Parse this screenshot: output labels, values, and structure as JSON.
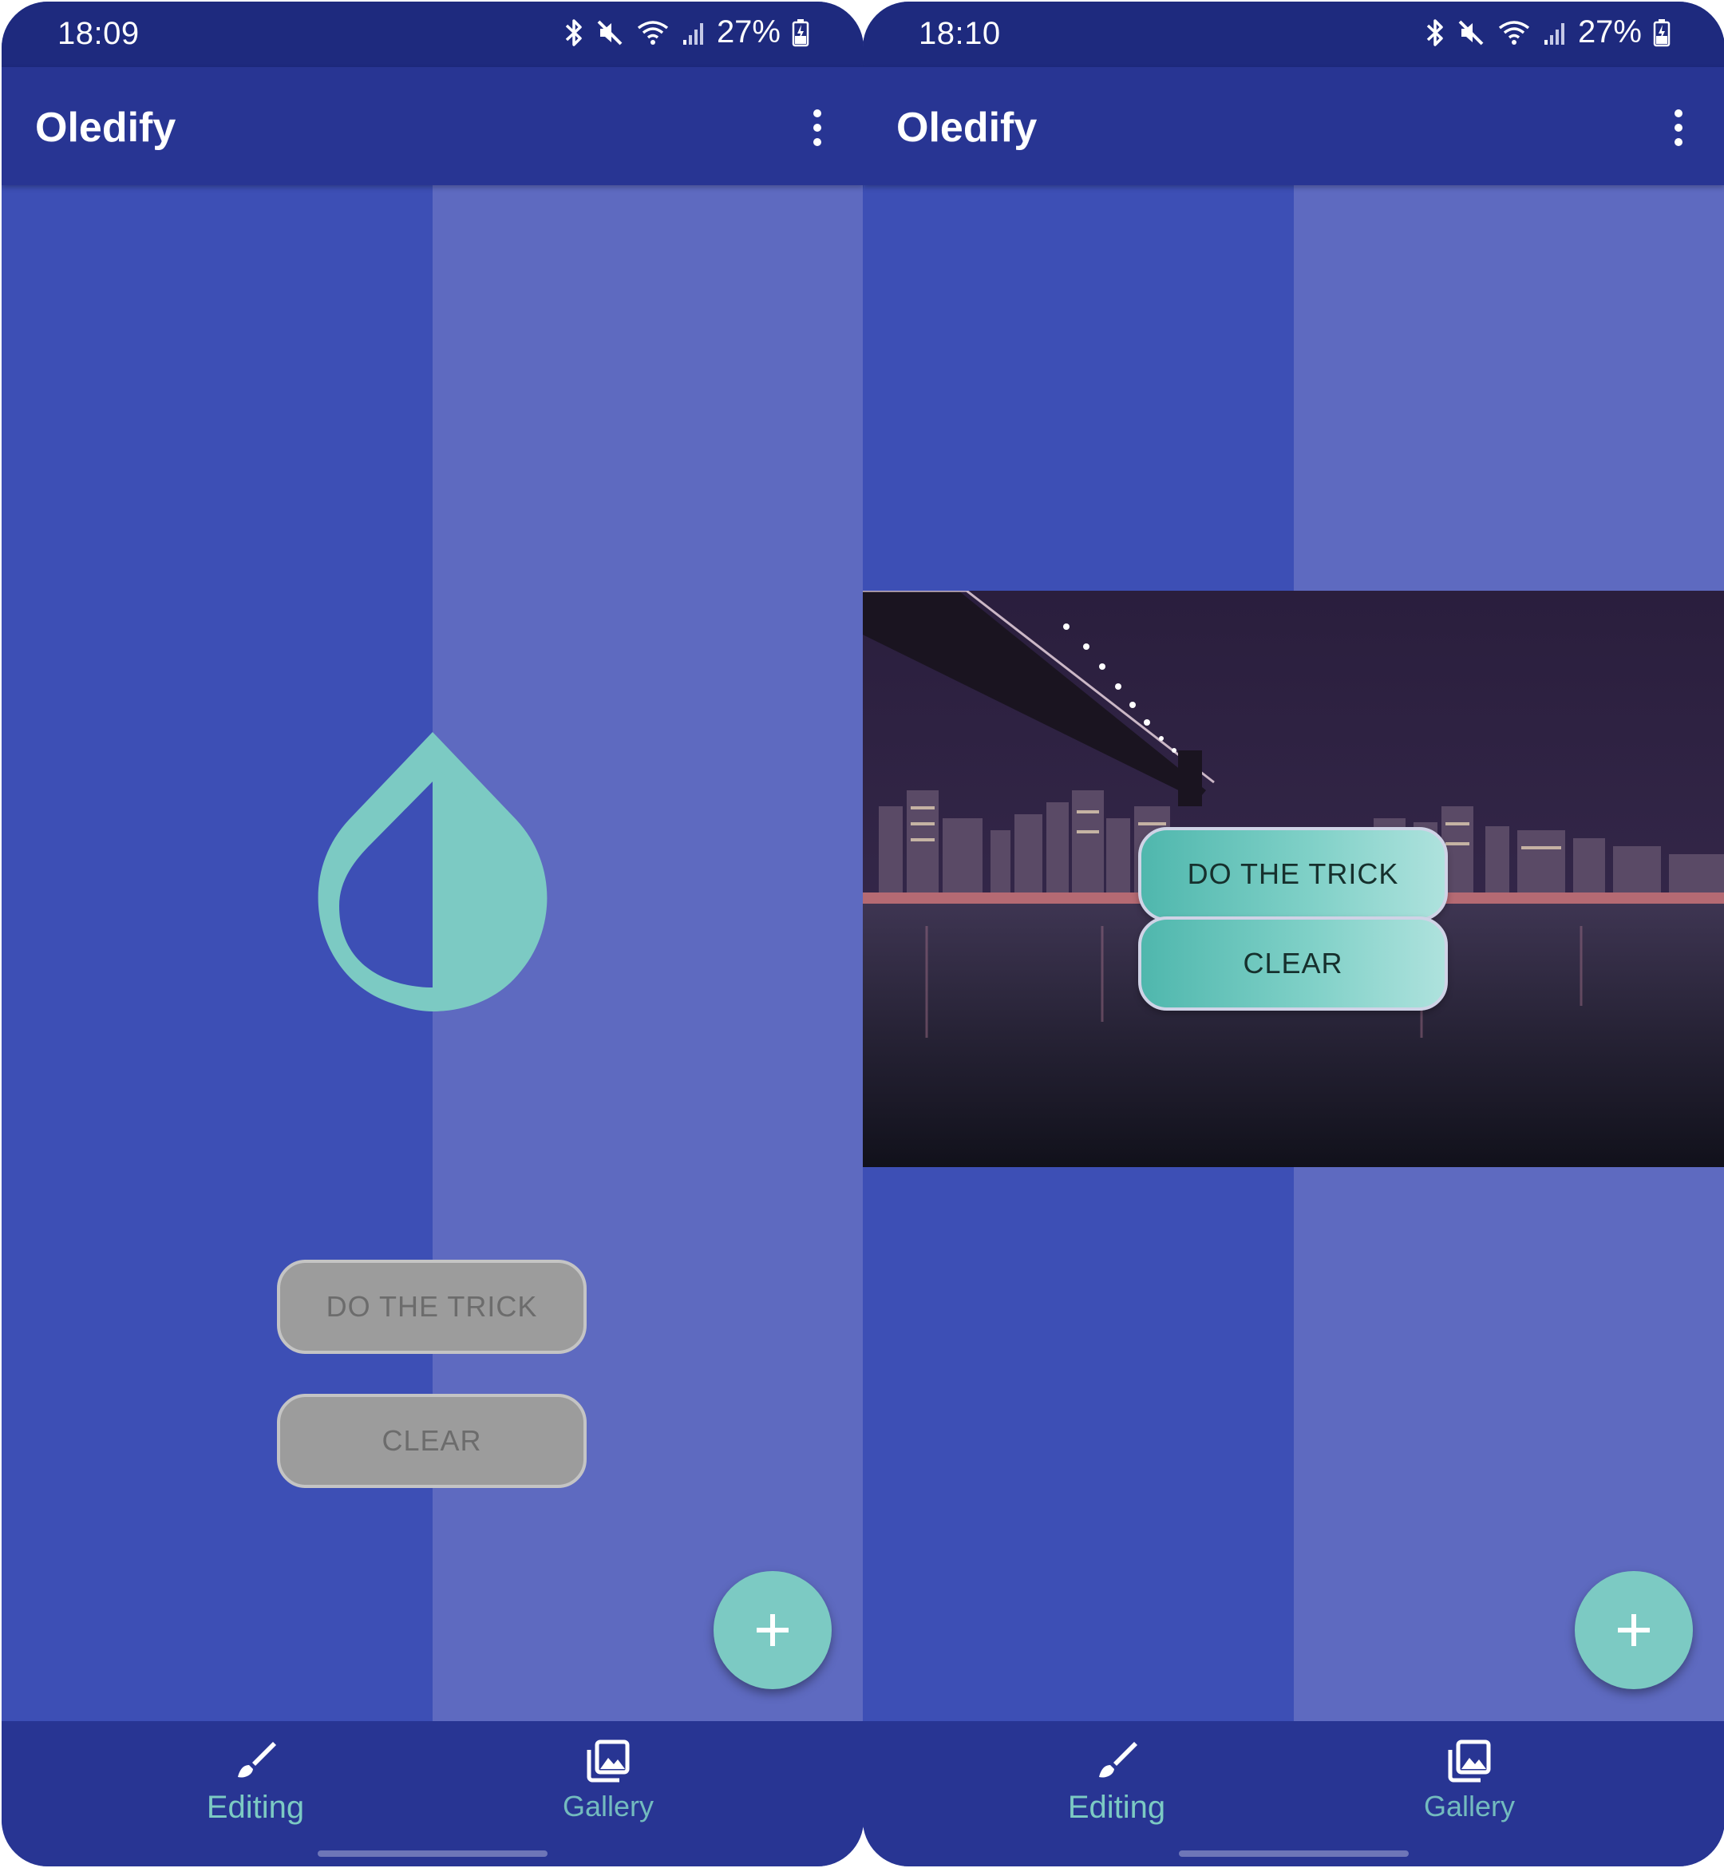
{
  "screens": [
    {
      "status": {
        "time": "18:09",
        "battery": "27%"
      },
      "app_bar": {
        "title": "Oledify"
      },
      "buttons": {
        "do_trick": "DO THE TRICK",
        "clear": "CLEAR",
        "state": "disabled"
      },
      "nav": {
        "editing": "Editing",
        "gallery": "Gallery"
      }
    },
    {
      "status": {
        "time": "18:10",
        "battery": "27%"
      },
      "app_bar": {
        "title": "Oledify"
      },
      "buttons": {
        "do_trick": "DO THE TRICK",
        "clear": "CLEAR",
        "state": "enabled"
      },
      "nav": {
        "editing": "Editing",
        "gallery": "Gallery"
      }
    }
  ],
  "colors": {
    "status_bar": "#1e2a7e",
    "app_bar": "#283593",
    "bg_left": "#3d4fb5",
    "bg_right": "#5e6ac0",
    "accent": "#7ccac3"
  },
  "icons": {
    "status": [
      "bluetooth-icon",
      "mute-icon",
      "wifi-icon",
      "signal-icon",
      "battery-icon"
    ],
    "menu": "more-vert-icon",
    "fab": "plus-icon",
    "nav_editing": "brush-icon",
    "nav_gallery": "gallery-icon",
    "logo": "drop-icon"
  }
}
